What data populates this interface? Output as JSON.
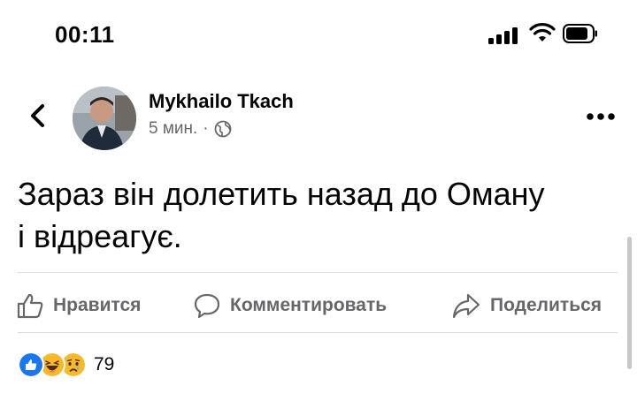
{
  "status_bar": {
    "time": "00:11"
  },
  "post": {
    "author": "Mykhailo Tkach",
    "time_ago": "5 мин.",
    "separator": "·",
    "text_line1": "Зараз він долетить назад до Оману",
    "text_line2": "і відреагує."
  },
  "actions": {
    "like_label": "Нравится",
    "comment_label": "Комментировать",
    "share_label": "Поделиться"
  },
  "reactions": {
    "count": "79",
    "icons": [
      "like-icon",
      "haha-icon",
      "sad-icon"
    ]
  },
  "colors": {
    "text": "#050505",
    "secondary": "#65676b",
    "like_blue": "#1877f2",
    "emoji_yellow": "#f7b928",
    "divider": "#dadde1"
  }
}
